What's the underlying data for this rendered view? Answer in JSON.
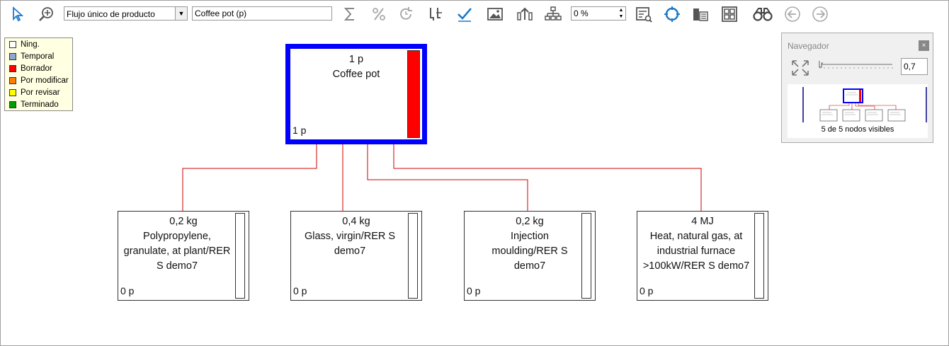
{
  "toolbar": {
    "view_select": "Flujo único de producto",
    "product_field": "Coffee pot (p)",
    "percent_field": "0 %",
    "icons": [
      "pointer-icon",
      "zoom-icon",
      "sum-icon",
      "percent-icon",
      "refresh-icon",
      "cutoff-icon",
      "check-icon",
      "image-icon",
      "move-up-icon",
      "tree-icon",
      "report-icon",
      "target-icon",
      "chart-icon",
      "grid-icon",
      "binoculars-icon",
      "back-icon",
      "forward-icon"
    ]
  },
  "legend": {
    "items": [
      {
        "label": "Ning.",
        "color": "#ffffff"
      },
      {
        "label": "Temporal",
        "color": "#8fa8d0"
      },
      {
        "label": "Borrador",
        "color": "#ff0000"
      },
      {
        "label": "Por modificar",
        "color": "#ff8000"
      },
      {
        "label": "Por revisar",
        "color": "#ffff00"
      },
      {
        "label": "Terminado",
        "color": "#00a000"
      }
    ]
  },
  "root_node": {
    "qty": "1 p",
    "name": "Coffee pot",
    "bottom": "1 p",
    "border_color": "#0000ff",
    "bar_color": "#ff0000"
  },
  "nodes": [
    {
      "qty": "0,2 kg",
      "name": "Polypropylene, granulate, at plant/RER S demo7",
      "bottom": "0 p"
    },
    {
      "qty": "0,4 kg",
      "name": "Glass, virgin/RER S demo7",
      "bottom": "0 p"
    },
    {
      "qty": "0,2 kg",
      "name": "Injection moulding/RER S demo7",
      "bottom": "0 p"
    },
    {
      "qty": "4 MJ",
      "name": "Heat, natural gas, at industrial furnace >100kW/RER S demo7",
      "bottom": "0 p"
    }
  ],
  "link_color": "#cc0000",
  "navigator": {
    "title": "Navegador",
    "close": "×",
    "zoom_value": "0,7",
    "status": "5 de 5 nodos visibles"
  }
}
